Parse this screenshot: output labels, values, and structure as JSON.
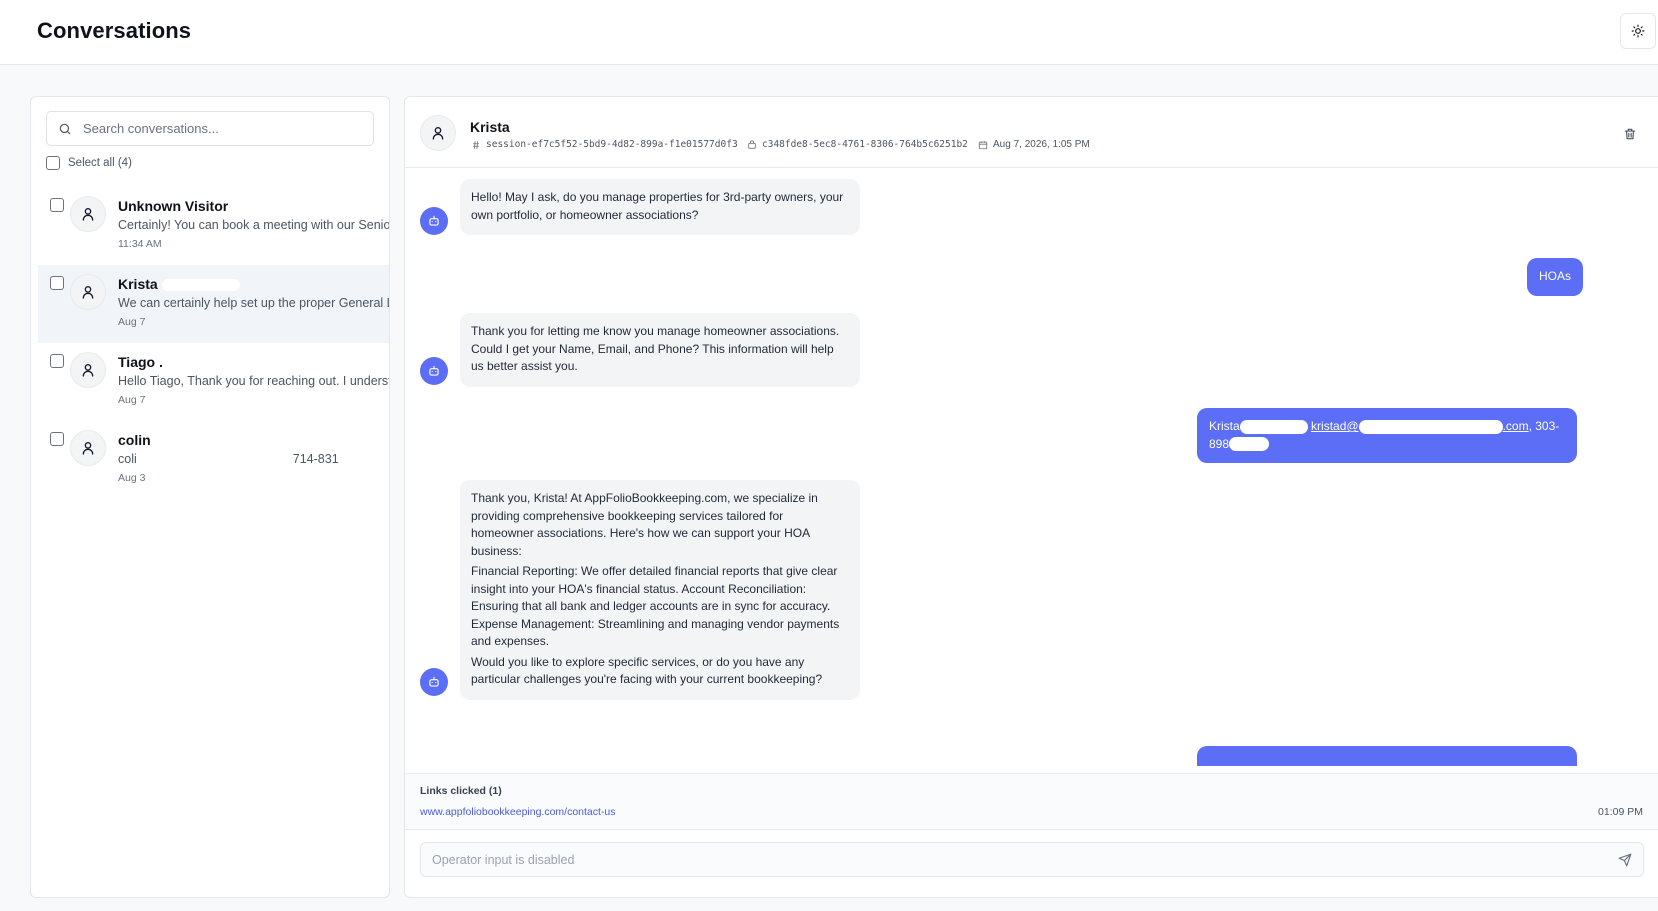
{
  "header": {
    "title": "Conversations",
    "theme_icon": "sun-icon"
  },
  "sidebar": {
    "search_placeholder": "Search conversations...",
    "select_all_label": "Select all (4)",
    "conversations": [
      {
        "name": "Unknown Visitor",
        "preview": "Certainly! You can book a meeting with our Senior",
        "time": "11:34 AM",
        "active": false
      },
      {
        "name": "Krista",
        "preview": "We can certainly help set up the proper General Led",
        "time": "Aug 7",
        "active": true
      },
      {
        "name": "Tiago .",
        "preview": "Hello Tiago, Thank you for reaching out. I understan",
        "time": "Aug 7",
        "active": false
      },
      {
        "name": "colin",
        "preview_start": "coli",
        "preview_end": "714-831",
        "time": "Aug 3",
        "active": false
      }
    ]
  },
  "chat": {
    "contact_name": "Krista",
    "session_id": "session-ef7c5f52-5bd9-4d82-899a-f1e01577d0f3",
    "visitor_id": "c348fde8-5ec8-4761-8306-764b5c6251b2",
    "date": "Aug 7, 2026, 1:05 PM",
    "messages": {
      "m1": "Hello! May I ask, do you manage properties for 3rd-party owners, your own portfolio, or homeowner associations?",
      "m2": "HOAs",
      "m3": "Thank you for letting me know you manage homeowner associations. Could I get your Name, Email, and Phone? This information will help us better assist you.",
      "m4": {
        "name": "Krista",
        "email_start": "kristad@",
        "email_end": ".com",
        "phone_start": ", 303-",
        "phone_line2": "898"
      },
      "m5": {
        "p1": "Thank you, Krista! At AppFolioBookkeeping.com, we specialize in providing comprehensive bookkeeping services tailored for homeowner associations. Here's how we can support your HOA business:",
        "p2": "Financial Reporting: We offer detailed financial reports that give clear insight into your HOA's financial status. Account Reconciliation: Ensuring that all bank and ledger accounts are in sync for accuracy. Expense Management: Streamlining and managing vendor payments and expenses.",
        "p3": "Would you like to explore specific services, or do you have any particular challenges you're facing with your current bookkeeping?"
      }
    },
    "links": {
      "title": "Links clicked (1)",
      "url": "www.appfoliobookkeeping.com/contact-us",
      "time": "01:09 PM"
    },
    "operator_placeholder": "Operator input is disabled"
  },
  "colors": {
    "accent": "#5b6ef5",
    "bubble_bg": "#f3f4f6",
    "active_row": "#f1f4f8"
  }
}
